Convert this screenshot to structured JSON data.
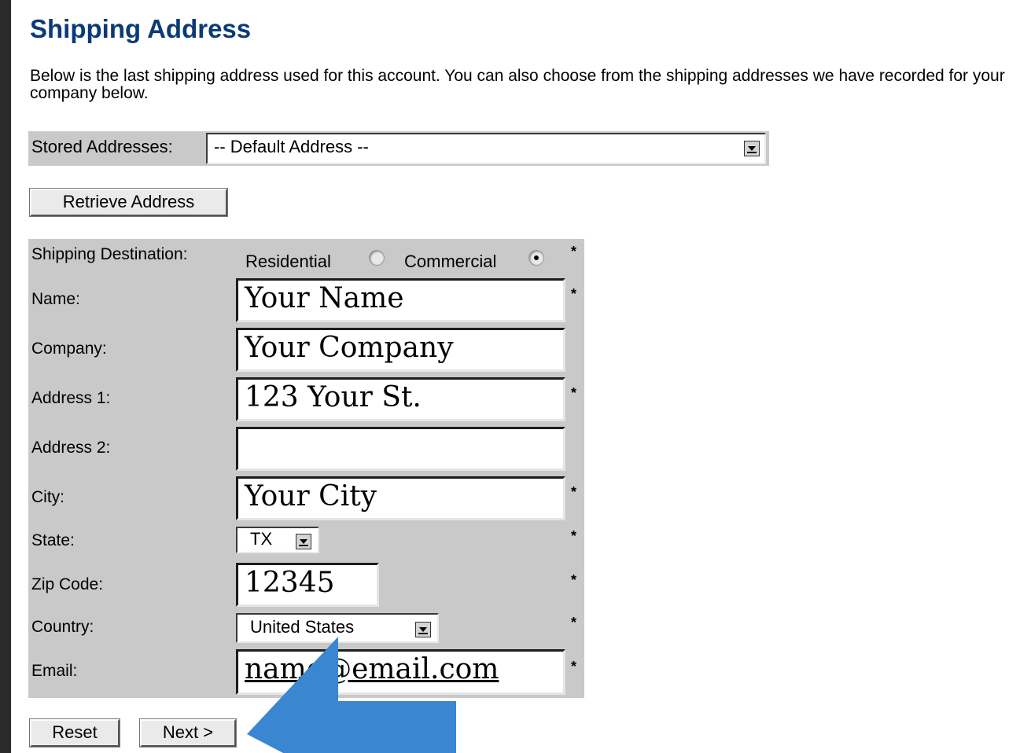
{
  "header": {
    "title": "Shipping Address",
    "intro": "Below is the last shipping address used for this account. You can also choose from the shipping addresses we have recorded for your company below."
  },
  "stored": {
    "label": "Stored Addresses:",
    "selected": "-- Default Address --",
    "retrieve_label": "Retrieve Address"
  },
  "form": {
    "destination_label": "Shipping Destination:",
    "residential_label": "Residential",
    "commercial_label": "Commercial",
    "destination_selected": "Commercial",
    "name_label": "Name:",
    "name_value": "Your Name",
    "company_label": "Company:",
    "company_value": "Your Company",
    "address1_label": "Address 1:",
    "address1_value": "123 Your St.",
    "address2_label": "Address 2:",
    "address2_value": "",
    "city_label": "City:",
    "city_value": "Your City",
    "state_label": "State:",
    "state_value": "TX",
    "zip_label": "Zip Code:",
    "zip_value": "12345",
    "country_label": "Country:",
    "country_value": "United States",
    "email_label": "Email:",
    "email_value": "name@email.com",
    "required_mark": "*"
  },
  "actions": {
    "reset_label": "Reset",
    "next_label": "Next >"
  },
  "annotation": {
    "arrow_color": "#3a86d0",
    "arrow_icon": "arrow-up-left-icon"
  }
}
